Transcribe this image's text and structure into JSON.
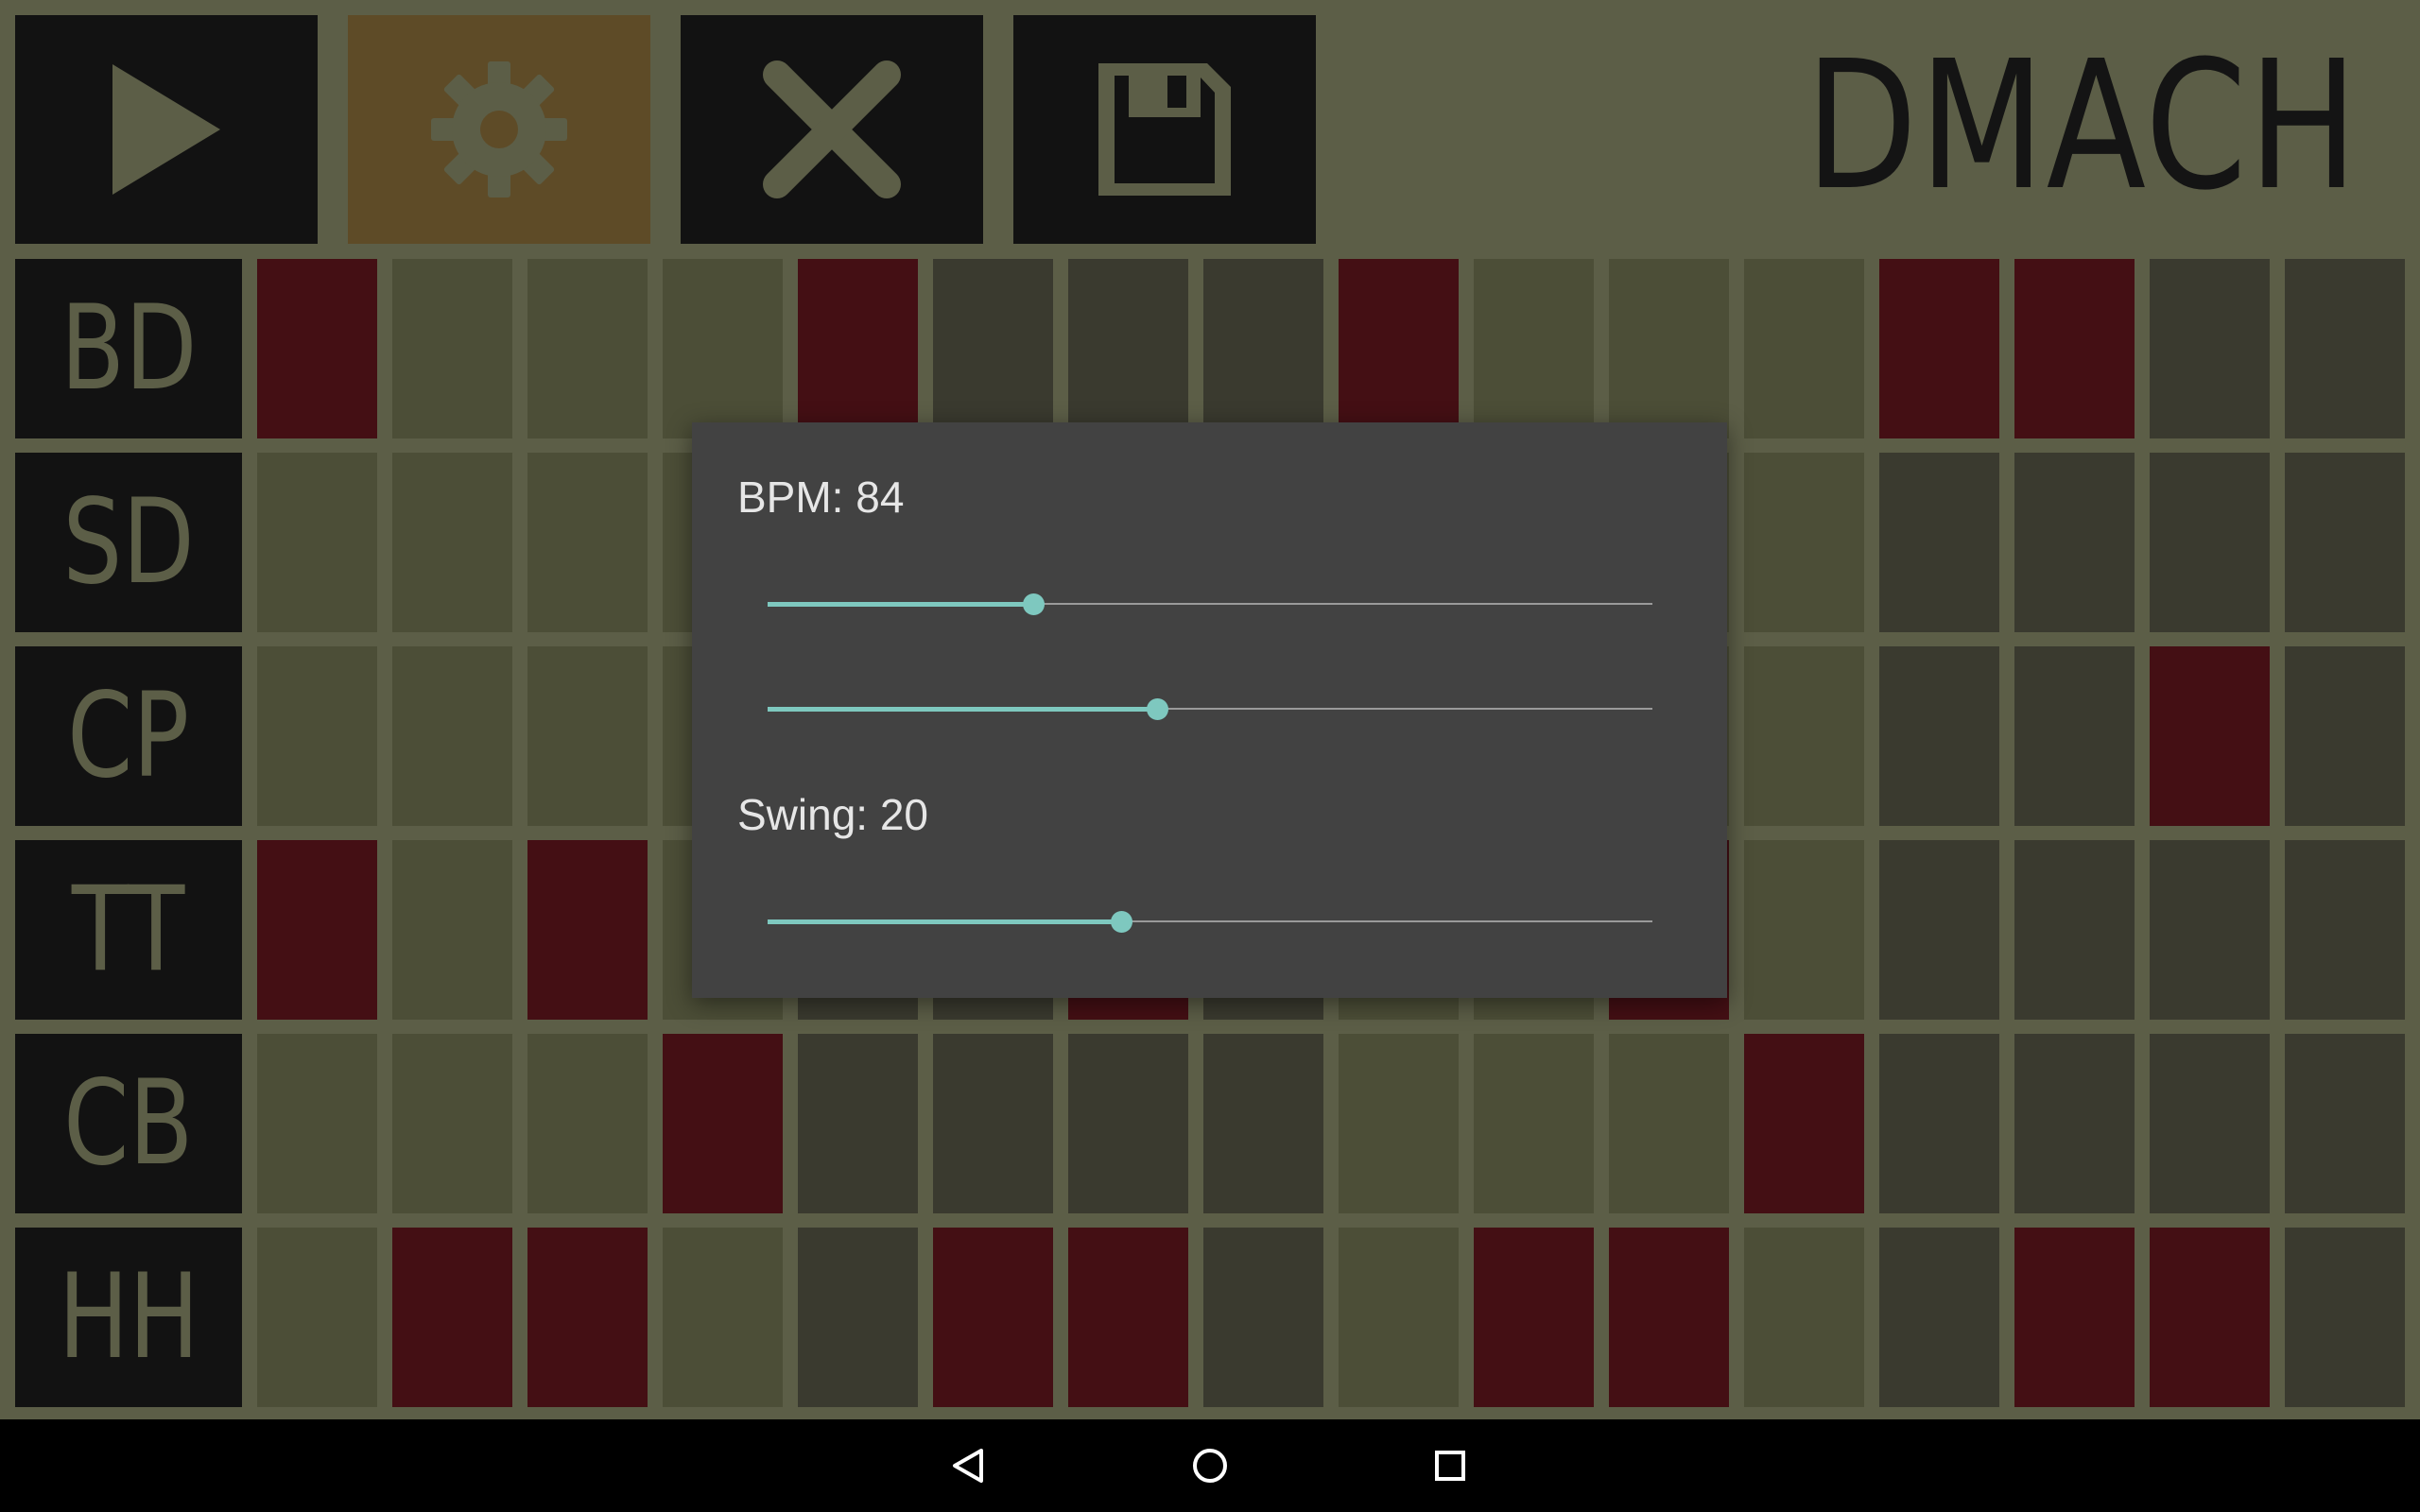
{
  "app": {
    "title": "DMACH"
  },
  "toolbar": {
    "buttons": [
      {
        "name": "play-button",
        "icon": "play-icon",
        "active": false
      },
      {
        "name": "settings-button",
        "icon": "gear-icon",
        "active": true
      },
      {
        "name": "clear-button",
        "icon": "close-icon",
        "active": false
      },
      {
        "name": "save-button",
        "icon": "floppy-disk-icon",
        "active": false
      }
    ]
  },
  "sequencer": {
    "tracks": [
      {
        "label": "BD",
        "steps": [
          1,
          0,
          0,
          0,
          1,
          0,
          0,
          0,
          1,
          0,
          0,
          0,
          1,
          1,
          0,
          0
        ]
      },
      {
        "label": "SD",
        "steps": [
          0,
          0,
          0,
          0,
          0,
          0,
          0,
          0,
          0,
          0,
          0,
          0,
          0,
          0,
          0,
          0
        ]
      },
      {
        "label": "CP",
        "steps": [
          0,
          0,
          0,
          0,
          0,
          0,
          0,
          0,
          0,
          0,
          0,
          0,
          0,
          0,
          1,
          0
        ]
      },
      {
        "label": "TT",
        "steps": [
          1,
          0,
          1,
          0,
          0,
          0,
          1,
          0,
          0,
          0,
          1,
          0,
          0,
          0,
          0,
          0
        ]
      },
      {
        "label": "CB",
        "steps": [
          0,
          0,
          0,
          1,
          0,
          0,
          0,
          0,
          0,
          0,
          0,
          1,
          0,
          0,
          0,
          0
        ]
      },
      {
        "label": "HH",
        "steps": [
          0,
          1,
          1,
          0,
          0,
          1,
          1,
          0,
          0,
          1,
          1,
          0,
          0,
          1,
          1,
          0
        ]
      }
    ],
    "colors": {
      "step_on": "#440f14",
      "step_off_light": "#4c4e37",
      "step_off_dark": "#3a3a2f",
      "background": "#5c5e47"
    }
  },
  "settings_dialog": {
    "bpm_label": "BPM: 84",
    "swing_label": "Swing: 20",
    "sliders": [
      {
        "name": "bpm-slider",
        "value": 0.3
      },
      {
        "name": "second-slider",
        "value": 0.44
      },
      {
        "name": "swing-slider",
        "value": 0.4
      }
    ],
    "accent_color": "#7ec8bf"
  },
  "navigation_bar": {
    "buttons": [
      {
        "name": "back-button",
        "icon": "back-triangle-icon"
      },
      {
        "name": "home-button",
        "icon": "home-circle-icon"
      },
      {
        "name": "recents-button",
        "icon": "recents-square-icon"
      }
    ]
  }
}
